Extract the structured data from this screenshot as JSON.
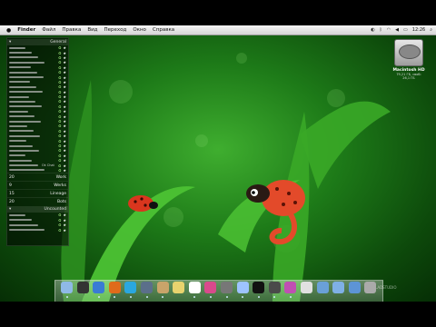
{
  "menubar": {
    "apple": "",
    "items": [
      "Finder",
      "Файл",
      "Правка",
      "Вид",
      "Переход",
      "Окно",
      "Справка"
    ],
    "time": "12:26"
  },
  "sidebar": {
    "header": "General",
    "group1": [
      {
        "label": "20",
        "name": "Work"
      },
      {
        "label": "9",
        "name": "Werks"
      },
      {
        "label": "15",
        "name": "Lineage"
      },
      {
        "label": "20",
        "name": "Bots"
      }
    ],
    "row_note": "Ok Chat",
    "footer_header": "Uncounted"
  },
  "hd": {
    "name": "Macintosh HD",
    "info": "79,21 ГБ, своб: 26,1 ГБ"
  },
  "watermark": "© VLADSTUDIO",
  "colors": {
    "accent": "#1d7a18",
    "ladybug": "#d9361e",
    "chameleon": "#e34a2a"
  },
  "dock": {
    "icons": [
      "finder-icon",
      "dashboard-icon",
      "safari-icon",
      "firefox-icon",
      "skype-icon",
      "mail-icon",
      "preview-icon",
      "notes-icon",
      "ical-icon",
      "itunes-icon",
      "photo-icon",
      "safari2-icon",
      "terminal-icon",
      "activity-icon",
      "itunes2-icon",
      "iphoto-icon",
      "folder-icon",
      "folder2-icon",
      "downloads-icon",
      "trash-icon"
    ]
  }
}
